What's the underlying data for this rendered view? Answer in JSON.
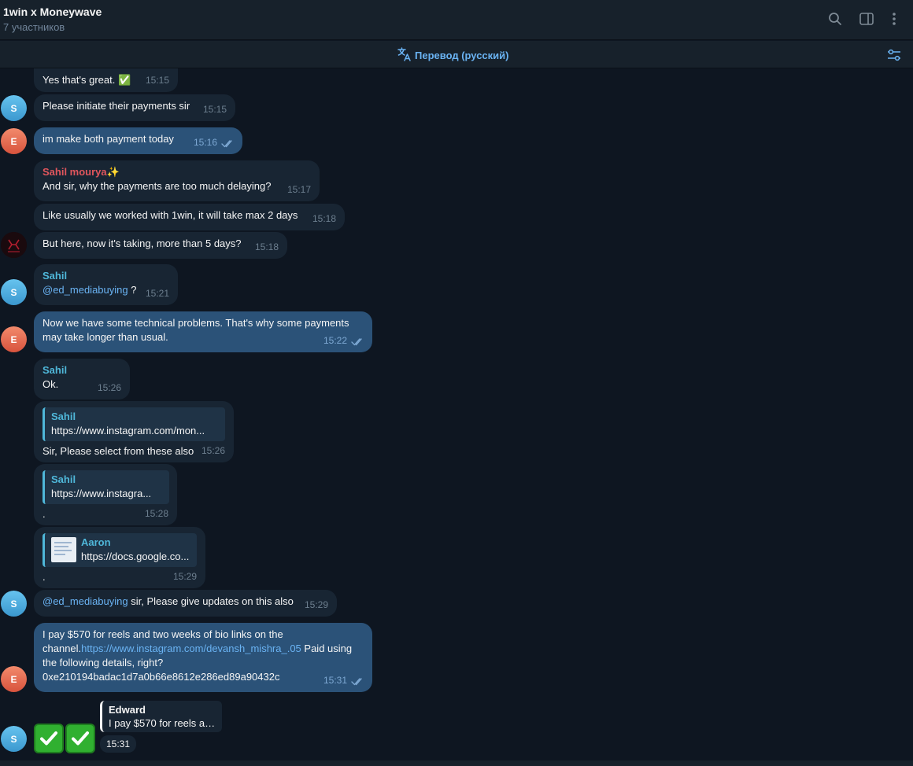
{
  "header": {
    "title": "1win x Moneywave",
    "subtitle": "7 участников"
  },
  "translate_bar": {
    "label": "Перевод (русский)"
  },
  "messages": [
    {
      "text": "Yes that's great. ✅",
      "time": "15:15"
    },
    {
      "text": "Please initiate their payments sir",
      "time": "15:15",
      "avatar": "S"
    },
    {
      "text": "im make both payment today",
      "time": "15:16",
      "avatar": "E",
      "outgoing": true
    },
    {
      "sender": "Sahil mourya✨",
      "text": "And sir, why the payments are too much delaying?",
      "time": "15:17"
    },
    {
      "text": "Like usually we worked with 1win, it will take max 2 days",
      "time": "15:18"
    },
    {
      "text": "But here, now it's taking, more than 5 days?",
      "time": "15:18",
      "avatar_alt": "Moneywave logo"
    },
    {
      "sender": "Sahil",
      "mention": "@ed_mediabuying",
      "text": " ?",
      "time": "15:21",
      "avatar": "S"
    },
    {
      "text": "Now we have some technical problems. That's why some payments may take longer than usual.",
      "time": "15:22",
      "avatar": "E",
      "outgoing": true
    },
    {
      "sender": "Sahil",
      "text": "Ok.",
      "time": "15:26"
    },
    {
      "reply_name": "Sahil",
      "reply_text": "https://www.instagram.com/mon...",
      "text": "Sir, Please select from these also",
      "time": "15:26"
    },
    {
      "reply_name": "Sahil",
      "reply_text": "https://www.instagra...",
      "text": ".",
      "time": "15:28"
    },
    {
      "reply_name": "Aaron",
      "reply_text": "https://docs.google.co...",
      "text": ".",
      "time": "15:29"
    },
    {
      "mention": "@ed_mediabuying",
      "text": " sir, Please give updates on this also",
      "time": "15:29",
      "avatar": "S"
    },
    {
      "text_before": "I pay $570 for reels and two weeks of bio links on the channel.",
      "link": "https://www.instagram.com/devansh_mishra_.05",
      "text_after": " Paid using the following details, right?",
      "wallet": "0xe210194badac1d7a0b66e8612e286ed89a90432c",
      "time": "15:31",
      "avatar": "E",
      "outgoing": true
    },
    {
      "reply_name": "Edward",
      "reply_text": "I pay $570 for reels an...",
      "time": "15:31",
      "avatar": "S",
      "emoji": "✅✅"
    }
  ],
  "colors": {
    "background": "#0e1621",
    "header": "#17212b",
    "bubble_in": "#182533",
    "bubble_out": "#2b5278",
    "accent": "#6ab3f3",
    "sender_blue": "#4fb7d9",
    "sender_red": "#e1565d"
  },
  "icons": [
    "search-icon",
    "sidebar-toggle-icon",
    "more-vertical-icon",
    "translate-icon",
    "translate-settings-icon",
    "double-check-icon",
    "check-mark-emoji"
  ]
}
